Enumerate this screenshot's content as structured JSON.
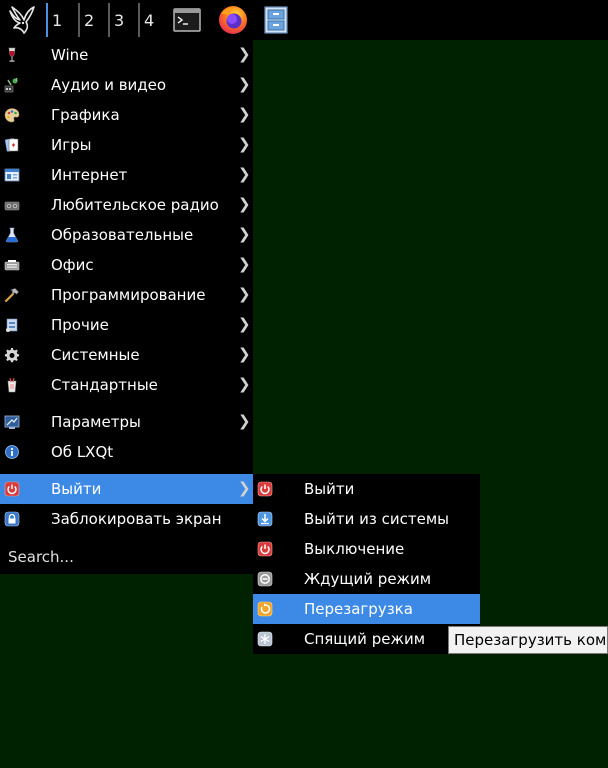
{
  "panel": {
    "desktops": [
      "1",
      "2",
      "3",
      "4"
    ],
    "active_desktop": "1"
  },
  "colors": {
    "desktop_bg": "#002200",
    "menu_bg": "#000000",
    "highlight": "#3d8ae6",
    "tooltip_bg": "#f2f2f2"
  },
  "main_menu": {
    "items": [
      {
        "label": "Wine",
        "icon": "wine-glass-icon",
        "has_submenu": true
      },
      {
        "label": "Аудио и видео",
        "icon": "multimedia-icon",
        "has_submenu": true
      },
      {
        "label": "Графика",
        "icon": "palette-icon",
        "has_submenu": true
      },
      {
        "label": "Игры",
        "icon": "cards-icon",
        "has_submenu": true
      },
      {
        "label": "Интернет",
        "icon": "network-icon",
        "has_submenu": true
      },
      {
        "label": "Любительское радио",
        "icon": "radio-icon",
        "has_submenu": true
      },
      {
        "label": "Образовательные",
        "icon": "flask-icon",
        "has_submenu": true
      },
      {
        "label": "Офис",
        "icon": "typewriter-icon",
        "has_submenu": true
      },
      {
        "label": "Программирование",
        "icon": "hammer-icon",
        "has_submenu": true
      },
      {
        "label": "Прочие",
        "icon": "misc-icon",
        "has_submenu": true
      },
      {
        "label": "Системные",
        "icon": "gear-icon",
        "has_submenu": true
      },
      {
        "label": "Стандартные",
        "icon": "accessories-icon",
        "has_submenu": true
      },
      {
        "label": "Параметры",
        "icon": "preferences-icon",
        "has_submenu": true
      },
      {
        "label": "Об LXQt",
        "icon": "info-icon",
        "has_submenu": false
      },
      {
        "label": "Выйти",
        "icon": "power-icon",
        "has_submenu": true
      },
      {
        "label": "Заблокировать экран",
        "icon": "lock-icon",
        "has_submenu": false
      }
    ],
    "arrow": "❯",
    "search_placeholder": "Search..."
  },
  "sub_menu": {
    "items": [
      {
        "label": "Выйти",
        "icon": "power-icon"
      },
      {
        "label": "Выйти из системы",
        "icon": "logout-icon"
      },
      {
        "label": "Выключение",
        "icon": "shutdown-icon"
      },
      {
        "label": "Ждущий режим",
        "icon": "suspend-icon"
      },
      {
        "label": "Перезагрузка",
        "icon": "reboot-icon"
      },
      {
        "label": "Спящий режим",
        "icon": "hibernate-icon"
      }
    ]
  },
  "tooltip": {
    "text": "Перезагрузить компьютер"
  }
}
